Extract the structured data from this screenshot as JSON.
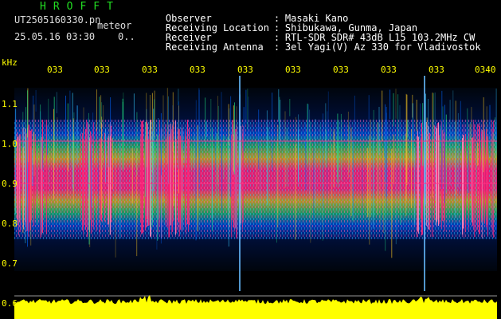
{
  "header": {
    "title": "HROFFT",
    "filename": "UT2505160330.pn",
    "filename_suffix": "meteor",
    "timestamp": "25.05.16 03:30    0.."
  },
  "metadata": [
    {
      "label": "Observer",
      "value": "Masaki Kano"
    },
    {
      "label": "Receiving Location",
      "value": "Shibukawa, Gunma, Japan"
    },
    {
      "label": "Receiver",
      "value": "RTL-SDR SDR# 43dB L15 103.2MHz CW"
    },
    {
      "label": "Receiving Antenna",
      "value": "3el Yagi(V) Az 330 for Vladivostok"
    }
  ],
  "axis": {
    "unit": "kHz",
    "y_ticks": [
      "1.1",
      "1.0",
      "0.9",
      "0.8",
      "0.7",
      "0.6"
    ],
    "x_ticks": [
      "033",
      "033",
      "033",
      "033",
      "033",
      "033",
      "033",
      "033",
      "033",
      "0340"
    ]
  },
  "colors": {
    "axis_text": "#ffff00",
    "title": "#22dd22",
    "background": "#000000",
    "signal_peak": "#ff2277",
    "noise": "#0044cc",
    "power_trace": "#ffff00"
  }
}
